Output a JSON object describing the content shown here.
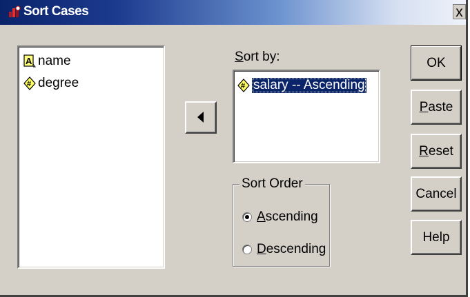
{
  "window": {
    "title": "Sort Cases",
    "close_glyph": "x"
  },
  "source_list": {
    "items": [
      {
        "label": "name",
        "icon": "string-variable-icon"
      },
      {
        "label": "degree",
        "icon": "numeric-variable-icon"
      }
    ]
  },
  "move_button": {
    "icon": "left-arrow-icon"
  },
  "sort_by": {
    "label_prefix": "S",
    "label_rest": "ort by:",
    "items": [
      {
        "label": "salary -- Ascending",
        "icon": "numeric-variable-icon",
        "selected": true
      }
    ]
  },
  "sort_order": {
    "legend": "Sort Order",
    "options": [
      {
        "accel": "A",
        "rest": "scending",
        "selected": true
      },
      {
        "accel": "D",
        "rest": "escending",
        "selected": false
      }
    ]
  },
  "buttons": {
    "ok": {
      "accel": "",
      "rest": "OK"
    },
    "paste": {
      "accel": "P",
      "rest": "aste"
    },
    "reset": {
      "accel": "R",
      "rest": "eset"
    },
    "cancel": {
      "accel": "",
      "rest": "Cancel"
    },
    "help": {
      "accel": "",
      "rest": "Help"
    }
  },
  "colors": {
    "title_start": "#0a246a",
    "dialog_face": "#d4d0c8",
    "selection": "#0a246a"
  }
}
